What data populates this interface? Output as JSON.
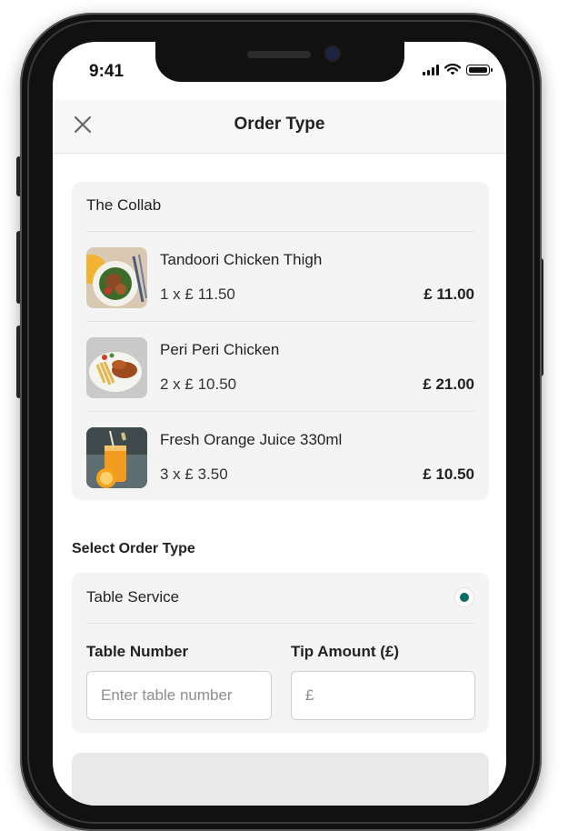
{
  "status_bar": {
    "time": "9:41"
  },
  "header": {
    "title": "Order Type",
    "close_icon": "close-icon"
  },
  "order": {
    "venue": "The Collab",
    "items": [
      {
        "name": "Tandoori Chicken Thigh",
        "qty_price": "1 x £ 11.50",
        "total": "£ 11.00"
      },
      {
        "name": "Peri Peri Chicken",
        "qty_price": "2 x £ 10.50",
        "total": "£ 21.00"
      },
      {
        "name": "Fresh Orange Juice 330ml",
        "qty_price": "3 x £ 3.50",
        "total": "£ 10.50"
      }
    ]
  },
  "order_type": {
    "section_label": "Select Order Type",
    "option_label": "Table Service",
    "selected": true,
    "accent_color": "#0c6b66",
    "table_number": {
      "label": "Table Number",
      "placeholder": "Enter table number",
      "value": ""
    },
    "tip_amount": {
      "label": "Tip Amount (£)",
      "placeholder": "£",
      "value": ""
    }
  }
}
